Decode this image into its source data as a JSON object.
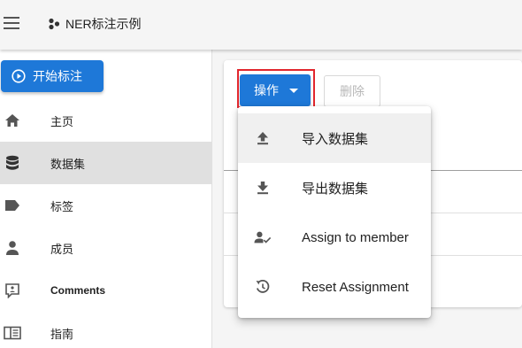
{
  "appbar": {
    "title": "NER标注示例"
  },
  "sidebar": {
    "start_label": "开始标注",
    "items": [
      {
        "label": "主页",
        "icon": "home-icon"
      },
      {
        "label": "数据集",
        "icon": "database-icon"
      },
      {
        "label": "标签",
        "icon": "label-icon"
      },
      {
        "label": "成员",
        "icon": "person-icon"
      },
      {
        "label": "Comments",
        "icon": "comment-icon"
      },
      {
        "label": "指南",
        "icon": "book-icon"
      }
    ]
  },
  "toolbar": {
    "actions_label": "操作",
    "delete_label": "删除"
  },
  "menu": {
    "items": [
      {
        "label": "导入数据集",
        "icon": "upload-icon"
      },
      {
        "label": "导出数据集",
        "icon": "download-icon"
      },
      {
        "label": "Assign to member",
        "icon": "person-check-icon"
      },
      {
        "label": "Reset Assignment",
        "icon": "reset-icon"
      }
    ]
  },
  "colors": {
    "primary": "#1e78d8",
    "highlight": "#e1262d",
    "active_nav": "#e0e0e0"
  }
}
